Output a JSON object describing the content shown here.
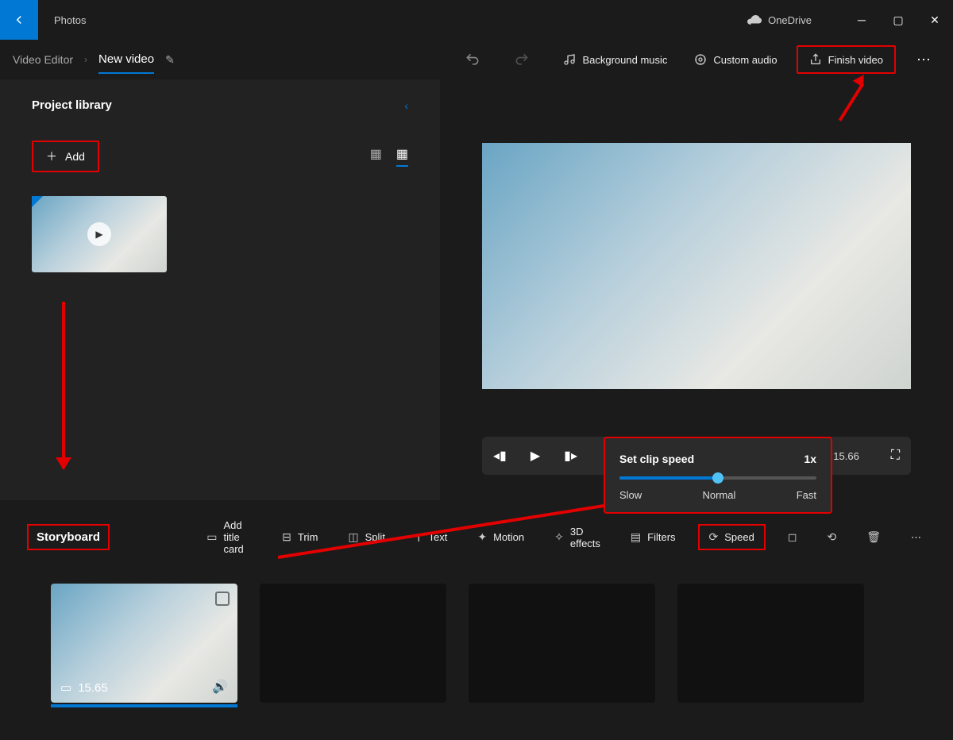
{
  "titlebar": {
    "app": "Photos",
    "onedrive": "OneDrive"
  },
  "header": {
    "breadcrumb": "Video Editor",
    "project": "New video",
    "undo": "↶",
    "redo": "↷",
    "bg_music": "Background music",
    "custom_audio": "Custom audio",
    "finish": "Finish video"
  },
  "library": {
    "title": "Project library",
    "add": "Add"
  },
  "speed_popup": {
    "title": "Set clip speed",
    "value": "1x",
    "slow": "Slow",
    "normal": "Normal",
    "fast": "Fast"
  },
  "playback": {
    "time": "0:15.66"
  },
  "storyboard": {
    "label": "Storyboard",
    "add_title": "Add title card",
    "trim": "Trim",
    "split": "Split",
    "text": "Text",
    "motion": "Motion",
    "effects3d": "3D effects",
    "filters": "Filters",
    "speed": "Speed",
    "clip_duration": "15.65"
  }
}
